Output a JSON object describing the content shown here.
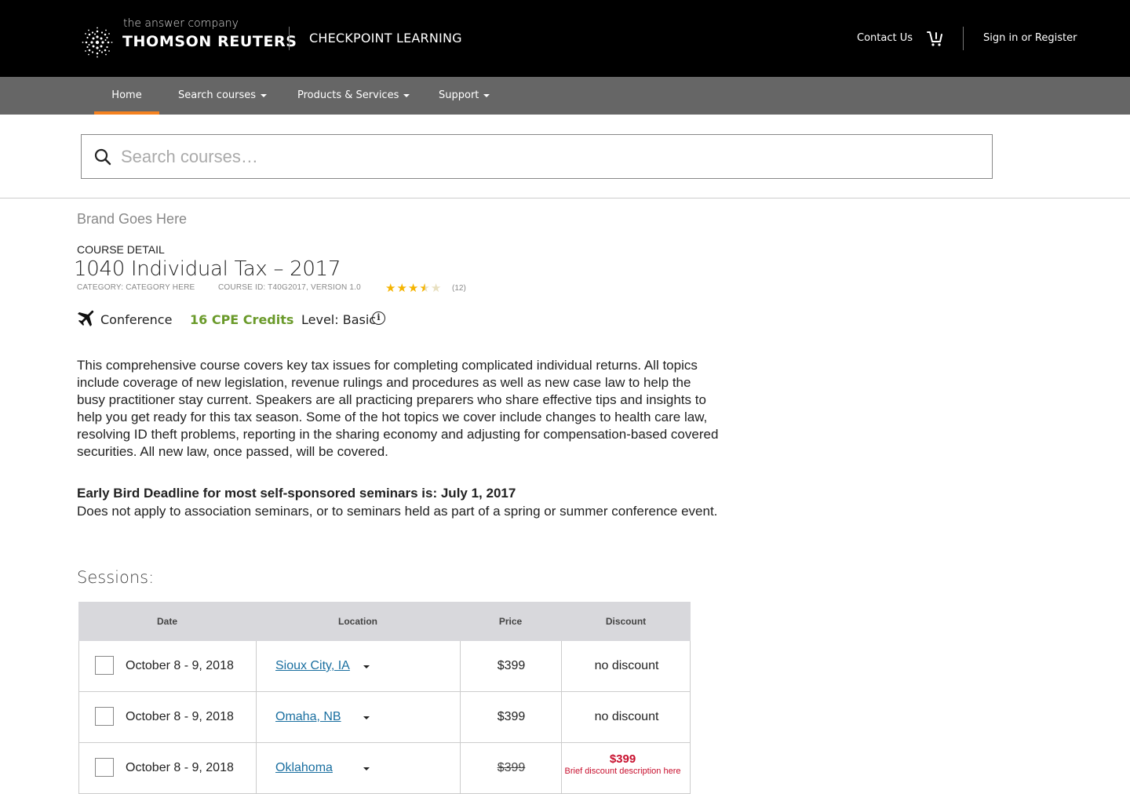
{
  "header": {
    "tagline": "the answer company",
    "brand": "THOMSON REUTERS",
    "product": "CHECKPOINT LEARNING",
    "contact_label": "Contact Us",
    "signin_label": "Sign in or Register"
  },
  "nav": {
    "items": [
      {
        "label": "Home",
        "active": true
      },
      {
        "label": "Search courses",
        "dropdown": true
      },
      {
        "label": "Products & Services",
        "dropdown": true
      },
      {
        "label": "Support",
        "dropdown": true
      }
    ]
  },
  "search": {
    "placeholder": "Search courses…"
  },
  "course": {
    "brand": "Brand Goes Here",
    "section_label": "COURSE DETAIL",
    "title": "1040 Individual Tax – 2017",
    "category": "CATEGORY: CATEGORY HERE",
    "course_id": "COURSE ID: T40G2017, VERSION 1.0",
    "rating": 3.5,
    "rating_count": "(12)",
    "format": "Conference",
    "credits": "16 CPE Credits",
    "level": "Level: Basic",
    "description": "This comprehensive course covers key tax issues for completing complicated individual returns. All topics include coverage of new legislation, revenue rulings and procedures as well as new case law to help the busy practitioner stay current. Speakers are all practicing preparers who share effective tips and insights to help you get ready for this tax season. Some of the hot topics we cover include changes to health care law, resolving ID theft problems, reporting in the sharing economy and adjusting for compensation-based covered securities. All new law, once passed, will be covered.",
    "early_bird_title": "Early Bird Deadline for most self-sponsored seminars is: July 1, 2017",
    "early_bird_note": "Does not apply to association seminars, or to seminars held as part of a spring or summer conference event."
  },
  "sessions": {
    "heading": "Sessions:",
    "columns": [
      "Date",
      "Location",
      "Price",
      "Discount"
    ],
    "rows": [
      {
        "date": "October 8 - 9, 2018",
        "location": "Sioux City, IA",
        "price": "$399",
        "discount": "no discount"
      },
      {
        "date": "October 8 - 9, 2018",
        "location": "Omaha, NB",
        "price": "$399",
        "discount": "no discount"
      },
      {
        "date": "October 8 - 9, 2018",
        "location": "Oklahoma",
        "price": "$399",
        "discount_price": "$399",
        "discount_desc": "Brief discount description here"
      }
    ]
  },
  "colors": {
    "topbar": "#000000",
    "navbar": "#666666",
    "nav_active_underline": "#f58220",
    "credits_green": "#6a9a2a",
    "link_blue": "#1a6fa0",
    "discount_red": "#c8102e",
    "star": "#f5b400"
  }
}
